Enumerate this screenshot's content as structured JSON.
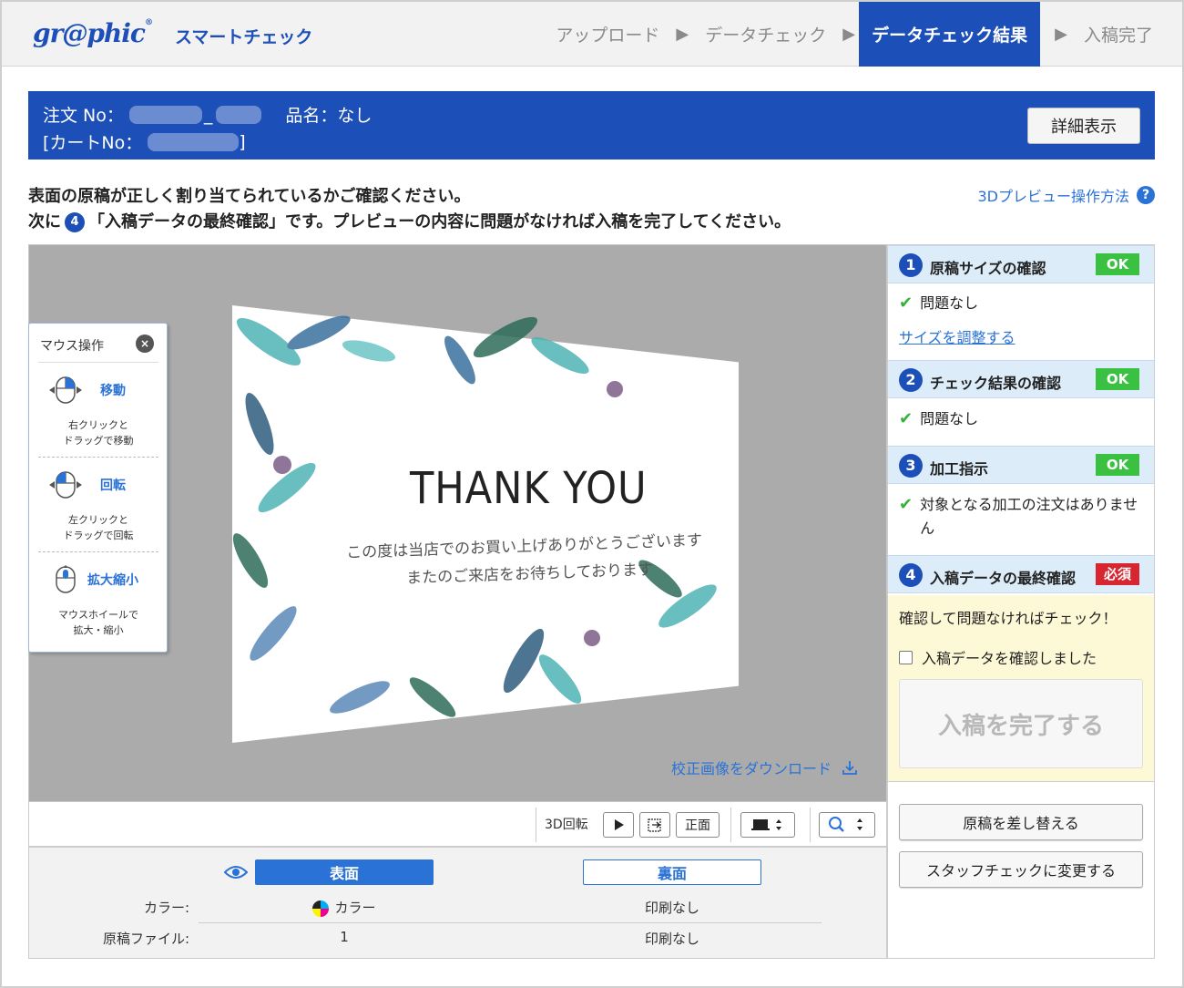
{
  "header": {
    "logo": "gr@phic",
    "logo_mark": "®",
    "app_title": "スマートチェック",
    "steps": [
      {
        "label": "アップロード"
      },
      {
        "label": "データチェック"
      },
      {
        "label": "データチェック結果",
        "active": true
      },
      {
        "label": "入稿完了"
      }
    ]
  },
  "order": {
    "order_no_label": "注文 No：",
    "order_no_sep": "_",
    "item_name": "品名：なし",
    "cart_no_open": "[カートNo：",
    "cart_no_close": "]",
    "detail_button": "詳細表示"
  },
  "instructions": {
    "line1": "表面の原稿が正しく割り当てられているかご確認ください。",
    "line2_prefix": "次に",
    "line2_num": "4",
    "line2_suffix": "「入稿データの最終確認」です。プレビューの内容に問題がなければ入稿を完了してください。",
    "help_link": "3Dプレビュー操作方法",
    "help_icon": "?"
  },
  "preview": {
    "card_title": "THANK YOU",
    "card_msg1": "この度は当店でのお買い上げありがとうございます",
    "card_msg2": "またのご来店をお待ちしております",
    "download_link": "校正画像をダウンロード"
  },
  "mouse_panel": {
    "title": "マウス操作",
    "close": "×",
    "sections": [
      {
        "label": "移動",
        "desc1": "右クリックと",
        "desc2": "ドラッグで移動"
      },
      {
        "label": "回転",
        "desc1": "左クリックと",
        "desc2": "ドラッグで回転"
      },
      {
        "label": "拡大縮小",
        "desc1": "マウスホイールで",
        "desc2": "拡大・縮小"
      }
    ]
  },
  "toolbar": {
    "rotate_label": "3D回転",
    "front_button": "正面"
  },
  "info": {
    "front_face": "表面",
    "back_face": "裏面",
    "color_label": "カラー:",
    "color_front": "カラー",
    "color_back": "印刷なし",
    "file_label": "原稿ファイル:",
    "file_front": "1",
    "file_back": "印刷なし"
  },
  "side": {
    "s1": {
      "num": "1",
      "title": "原稿サイズの確認",
      "badge": "OK",
      "result": "問題なし",
      "link": "サイズを調整する"
    },
    "s2": {
      "num": "2",
      "title": "チェック結果の確認",
      "badge": "OK",
      "result": "問題なし"
    },
    "s3": {
      "num": "3",
      "title": "加工指示",
      "badge": "OK",
      "result": "対象となる加工の注文はありません"
    },
    "s4": {
      "num": "4",
      "title": "入稿データの最終確認",
      "badge": "必須",
      "prompt": "確認して問題なければチェック！",
      "checkbox_label": "入稿データを確認しました",
      "complete_button": "入稿を完了する"
    },
    "replace_button": "原稿を差し替える",
    "staff_button": "スタッフチェックに変更する"
  },
  "colors": {
    "brand_blue": "#1d4fb8",
    "link_blue": "#2a72d6",
    "ok_green": "#3ac141",
    "required_red": "#d7262f"
  }
}
